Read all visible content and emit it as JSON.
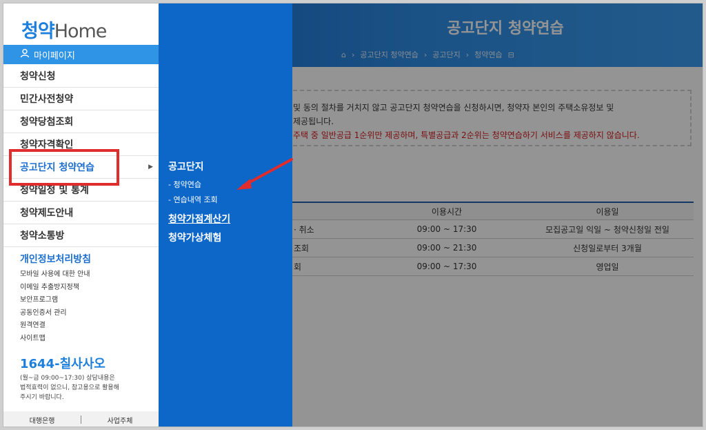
{
  "background": {
    "title": "공고단지 청약연습",
    "breadcrumb": [
      "공고단지 청약연습",
      "공고단지",
      "청약연습"
    ],
    "notice_line1": "및 동의 절차를 거치지 않고 공고단지 청약연습을 신청하시면, 청약자 본인의 주택소유정보 및",
    "notice_line2": "제공됩니다.",
    "notice_line3": "주택 중 일반공급 1순위만 제공하며, 특별공급과 2순위는 청약연습하기 서비스를 제공하지 않습니다.",
    "table": {
      "headers": [
        "",
        "이용시간",
        "이용일"
      ],
      "rows": [
        [
          "· 취소",
          "09:00 ~ 17:30",
          "모집공고일 익일 ~ 청약신청일 전일"
        ],
        [
          "조회",
          "09:00 ~ 21:30",
          "신청일로부터 3개월"
        ],
        [
          "회",
          "09:00 ~ 17:30",
          "영업일"
        ]
      ]
    }
  },
  "sidebar": {
    "logo_korean": "청약",
    "logo_english": "Home",
    "mypage_label": "마이페이지",
    "items": [
      {
        "label": "청약신청"
      },
      {
        "label": "민간사전청약"
      },
      {
        "label": "청약당첨조회"
      },
      {
        "label": "청약자격확인"
      },
      {
        "label": "공고단지 청약연습"
      },
      {
        "label": "청약일정 및 통계"
      },
      {
        "label": "청약제도안내"
      },
      {
        "label": "청약소통방"
      }
    ],
    "privacy_title": "개인정보처리방침",
    "links": [
      "모바일 사용에 대한 안내",
      "이메일 추출방지정책",
      "보안프로그램",
      "공동인증서 관리",
      "원격연결",
      "사이트맵"
    ],
    "phone": "1644-칠사사오",
    "hours_line1": "(월~금 09:00~17:30) 상담내용은",
    "hours_line2": "법적효력이 없으니, 참고용으로 활용해",
    "hours_line3": "주시기 바랍니다.",
    "footer": [
      "대행은행",
      "사업주체"
    ]
  },
  "submenu": {
    "heading": "공고단지",
    "sub_items": [
      "- 청약연습",
      "- 연습내역 조회"
    ],
    "calculator": "청약가점계산기",
    "experience": "청약가상체험"
  },
  "colors": {
    "accent": "#0c67c9",
    "highlight": "#e02c2c",
    "notice_red": "#d3191c"
  }
}
